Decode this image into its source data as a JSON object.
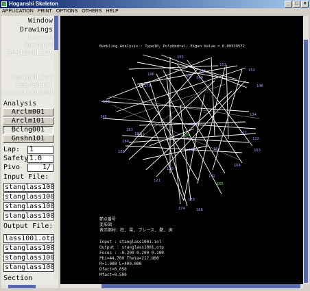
{
  "window": {
    "title": "Hoganshi Skeleton",
    "buttons": [
      "_",
      "□",
      "×"
    ]
  },
  "menu": [
    "APPLICATION",
    "PRINT",
    "OPTIONS",
    "OTHERS",
    "HELP"
  ],
  "left": {
    "nav_items": [
      "Window",
      "Drawings",
      "Errors",
      "Surface",
      "SectionList"
    ],
    "nav_items2": [
      "WeightList",
      "CmqDetail",
      "HorizontalLoad"
    ],
    "analysis_label": "Analysis",
    "analysis_buttons": [
      "Arclm001",
      "Arclm101",
      "Bclng001",
      "Gnshn101"
    ],
    "lap_label": "Lap:",
    "lap_value": "1",
    "safety_label": "Safety",
    "safety_value": "1.0",
    "pivo_label": "Pivo",
    "pivo_value": "1/",
    "input_file_label": "Input File:",
    "input_files": [
      "stanglass100",
      "stanglass100",
      "stanglass100",
      "stanglass100"
    ],
    "output_file_label": "Output File:",
    "output_files": [
      "lass1001.otp",
      "stanglass100",
      "stanglass100",
      "stanglass100"
    ],
    "section_label": "Section"
  },
  "canvas": {
    "header": "Buckling Analysis : Type10, Polyhedral, Eigen Value = 0.00339572",
    "legend": [
      "節点番号",
      "変形図",
      "表示部材：柱, 梁, ブレース, 壁, 床"
    ],
    "info": [
      "Input  : stanglass1001.inl",
      "Output : stanglass1001.otp",
      "Focus : -0.200 0.200 0.100",
      "Phi=44.700 Theta=217.800",
      "R=1.000 L=400.000",
      "Dfact=0.050",
      "Mfact=0.500"
    ],
    "node_labels": [
      {
        "t": "155",
        "c": "blue"
      },
      {
        "t": "153",
        "c": "blue"
      },
      {
        "t": "152",
        "c": "blue"
      },
      {
        "t": "146",
        "c": "blue"
      },
      {
        "t": "180",
        "c": "blue"
      },
      {
        "t": "148",
        "c": "blue"
      },
      {
        "t": "150",
        "c": "blue"
      },
      {
        "t": "140",
        "c": "blue"
      },
      {
        "t": "179",
        "c": "blue"
      },
      {
        "t": "160",
        "c": "blue"
      },
      {
        "t": "145",
        "c": "blue"
      },
      {
        "t": "134",
        "c": "blue"
      },
      {
        "t": "181",
        "c": "blue"
      },
      {
        "t": "127",
        "c": "blue"
      },
      {
        "t": "122",
        "c": "blue"
      },
      {
        "t": "121",
        "c": "blue"
      },
      {
        "t": "119",
        "c": "blue"
      },
      {
        "t": "104",
        "c": "blue"
      },
      {
        "t": "163",
        "c": "blue"
      },
      {
        "t": "164",
        "c": "blue"
      },
      {
        "t": "120",
        "c": "blue"
      },
      {
        "t": "121",
        "c": "blue"
      },
      {
        "t": "132",
        "c": "blue"
      },
      {
        "t": "174",
        "c": "blue"
      },
      {
        "t": "166",
        "c": "blue"
      },
      {
        "t": "173",
        "c": "blue"
      },
      {
        "t": "184",
        "c": "blue"
      },
      {
        "t": "185",
        "c": "blue"
      },
      {
        "t": "182",
        "c": "blue"
      },
      {
        "t": "108",
        "c": "green"
      },
      {
        "t": "165",
        "c": "green"
      },
      {
        "t": "192",
        "c": "white"
      }
    ]
  }
}
